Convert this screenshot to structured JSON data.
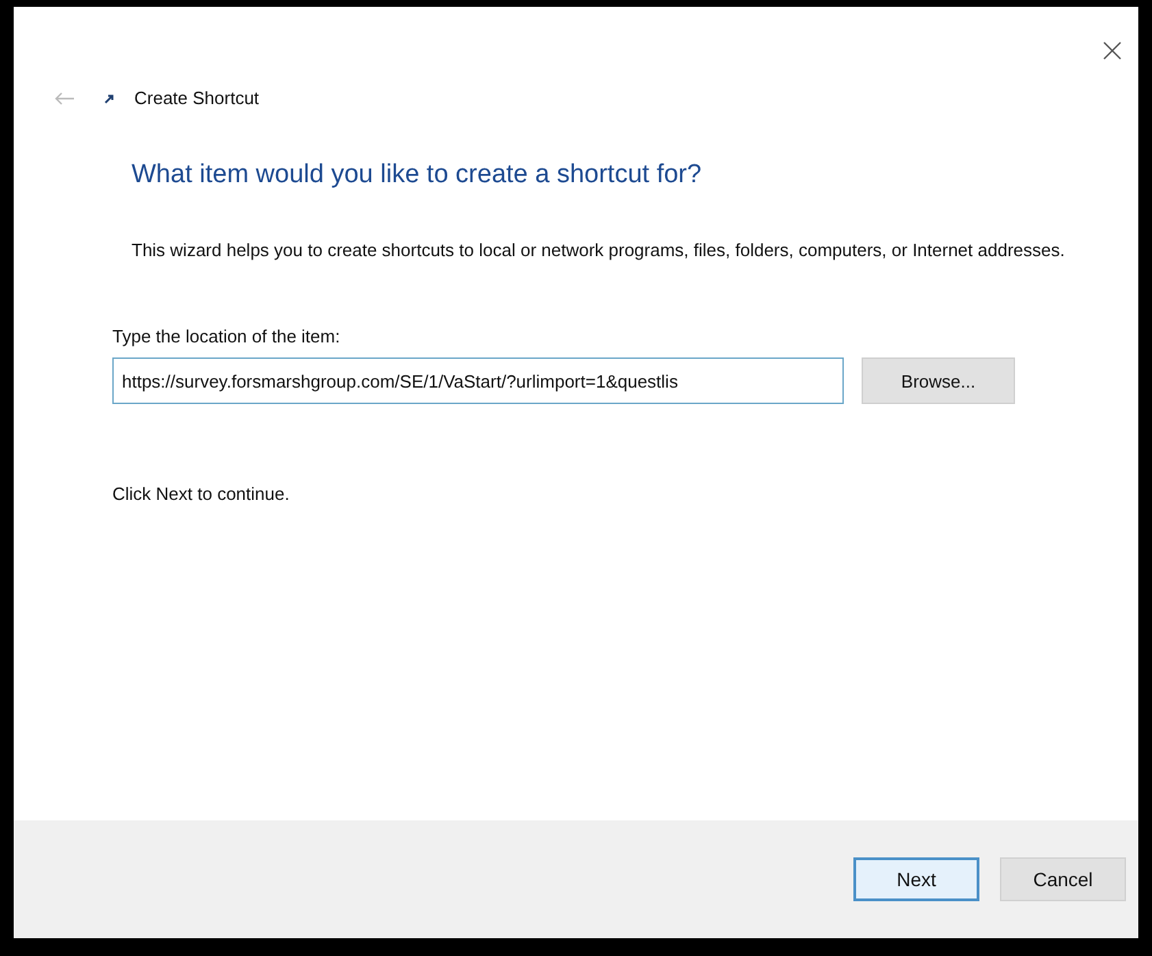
{
  "window": {
    "title": "Create Shortcut"
  },
  "heading": "What item would you like to create a shortcut for?",
  "description": "This wizard helps you to create shortcuts to local or network programs, files, folders, computers, or Internet addresses.",
  "location": {
    "label": "Type the location of the item:",
    "value": "https://survey.forsmarshgroup.com/SE/1/VaStart/?urlimport=1&questlis",
    "focused": true
  },
  "browse_button": "Browse...",
  "hint": "Click Next to continue.",
  "buttons": [
    {
      "label": "Next",
      "default": true
    },
    {
      "label": "Cancel",
      "default": false
    }
  ]
}
